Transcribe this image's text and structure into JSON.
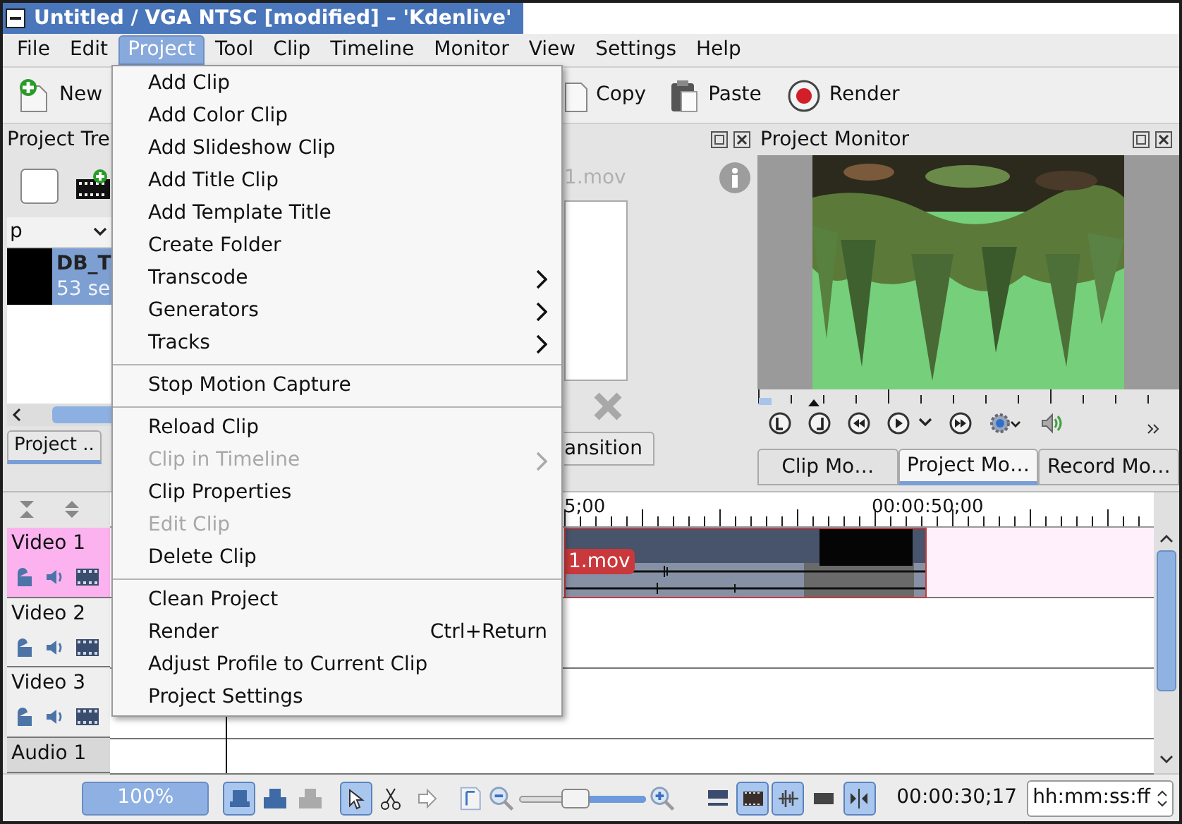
{
  "window": {
    "title": "Untitled / VGA NTSC [modified] – 'Kdenlive'"
  },
  "menubar": [
    {
      "label": "File",
      "selected": false
    },
    {
      "label": "Edit",
      "selected": false
    },
    {
      "label": "Project",
      "selected": true
    },
    {
      "label": "Tool",
      "selected": false
    },
    {
      "label": "Clip",
      "selected": false
    },
    {
      "label": "Timeline",
      "selected": false
    },
    {
      "label": "Monitor",
      "selected": false
    },
    {
      "label": "View",
      "selected": false
    },
    {
      "label": "Settings",
      "selected": false
    },
    {
      "label": "Help",
      "selected": false
    }
  ],
  "toolbar": [
    {
      "label": "New"
    },
    {
      "label": "Copy"
    },
    {
      "label": "Paste"
    },
    {
      "label": "Render"
    }
  ],
  "project_menu": [
    {
      "kind": "item",
      "label": "Add Clip",
      "disabled": false,
      "submenu": false
    },
    {
      "kind": "item",
      "label": "Add Color Clip",
      "disabled": false,
      "submenu": false
    },
    {
      "kind": "item",
      "label": "Add Slideshow Clip",
      "disabled": false,
      "submenu": false
    },
    {
      "kind": "item",
      "label": "Add Title Clip",
      "disabled": false,
      "submenu": false
    },
    {
      "kind": "item",
      "label": "Add Template Title",
      "disabled": false,
      "submenu": false
    },
    {
      "kind": "item",
      "label": "Create Folder",
      "disabled": false,
      "submenu": false
    },
    {
      "kind": "item",
      "label": "Transcode",
      "disabled": false,
      "submenu": true
    },
    {
      "kind": "item",
      "label": "Generators",
      "disabled": false,
      "submenu": true
    },
    {
      "kind": "item",
      "label": "Tracks",
      "disabled": false,
      "submenu": true
    },
    {
      "kind": "separator"
    },
    {
      "kind": "item",
      "label": "Stop Motion Capture",
      "disabled": false,
      "submenu": false
    },
    {
      "kind": "separator"
    },
    {
      "kind": "item",
      "label": "Reload Clip",
      "disabled": false,
      "submenu": false
    },
    {
      "kind": "item",
      "label": "Clip in Timeline",
      "disabled": true,
      "submenu": true
    },
    {
      "kind": "item",
      "label": "Clip Properties",
      "disabled": false,
      "submenu": false
    },
    {
      "kind": "item",
      "label": "Edit Clip",
      "disabled": true,
      "submenu": false
    },
    {
      "kind": "item",
      "label": "Delete Clip",
      "disabled": false,
      "submenu": false
    },
    {
      "kind": "separator"
    },
    {
      "kind": "item",
      "label": "Clean Project",
      "disabled": false,
      "submenu": false
    },
    {
      "kind": "item",
      "label": "Render",
      "shortcut": "Ctrl+Return",
      "disabled": false,
      "submenu": false
    },
    {
      "kind": "item",
      "label": "Adjust Profile to Current Clip",
      "disabled": false,
      "submenu": false
    },
    {
      "kind": "item",
      "label": "Project Settings",
      "disabled": false,
      "submenu": false
    }
  ],
  "project_tree": {
    "title": "Project Tre",
    "filter": "p",
    "clips": [
      {
        "name": "DB_T",
        "duration": "53 se",
        "selected": true
      }
    ],
    "tab": "Project .."
  },
  "clip_panel": {
    "filename": "1.mov",
    "tab": "ansition"
  },
  "project_monitor": {
    "title": "Project Monitor",
    "tabs": [
      {
        "label": "Clip Mo…",
        "selected": false
      },
      {
        "label": "Project Mo…",
        "selected": true
      },
      {
        "label": "Record Mo…",
        "selected": false
      }
    ]
  },
  "timeline": {
    "ruler": [
      "5;00",
      "00:00:50;00"
    ],
    "tracks": [
      {
        "name": "Video 1",
        "kind": "video",
        "selected": true
      },
      {
        "name": "Video 2",
        "kind": "video",
        "selected": false
      },
      {
        "name": "Video 3",
        "kind": "video",
        "selected": false
      },
      {
        "name": "Audio 1",
        "kind": "audio",
        "selected": false
      }
    ],
    "clips": [
      {
        "label": "1.mov"
      }
    ]
  },
  "status_bar": {
    "zoom": "100%",
    "tools": [
      {
        "selected": true
      },
      {
        "selected": false
      },
      {
        "selected": false
      },
      {
        "selected": true
      },
      {
        "selected": false
      },
      {
        "selected": false
      }
    ],
    "zoom_slider": {
      "level": 0.45
    },
    "view_toggles": [
      {
        "selected": false
      },
      {
        "selected": true
      },
      {
        "selected": true
      },
      {
        "selected": false
      },
      {
        "selected": true
      }
    ],
    "timecode": "00:00:30;17",
    "format": "hh:mm:ss:ff"
  }
}
